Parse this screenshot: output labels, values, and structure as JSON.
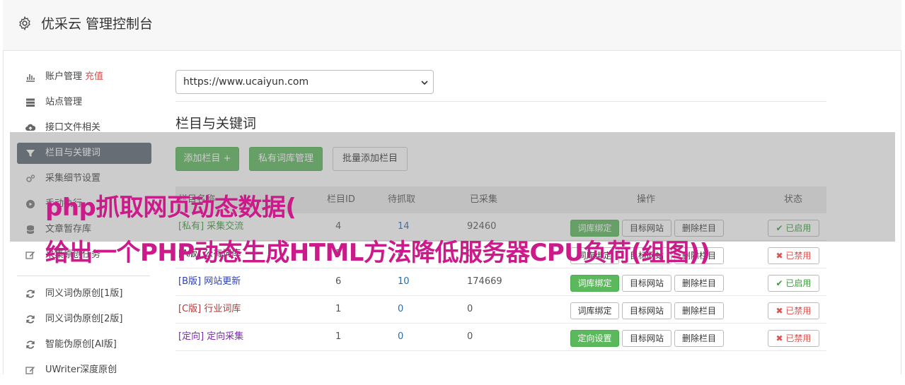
{
  "header": {
    "title": "优采云 管理控制台"
  },
  "sidebar": {
    "items": [
      {
        "label": "账户管理",
        "extra": "充值",
        "icon": "bar-chart-icon"
      },
      {
        "label": "站点管理",
        "icon": "server-icon"
      },
      {
        "label": "接口文件相关",
        "icon": "cloud-upload-icon"
      },
      {
        "label": "栏目与关键词",
        "icon": "filter-icon",
        "active": true
      },
      {
        "label": "采集细节设置",
        "icon": "cogs-icon"
      },
      {
        "label": "手动执行",
        "icon": "play-circle-icon"
      },
      {
        "label": "文章暂存库",
        "icon": "database-icon"
      },
      {
        "label": "采集原创任务",
        "icon": "edit-icon"
      }
    ],
    "items2": [
      {
        "label": "同义词伪原创[1版]",
        "icon": "refresh-icon"
      },
      {
        "label": "同义词伪原创[2版]",
        "icon": "refresh-icon"
      },
      {
        "label": "智能伪原创[AI版]",
        "icon": "refresh-icon"
      },
      {
        "label": "UWriter深度原创",
        "icon": "edit-icon"
      }
    ]
  },
  "site_select": {
    "value": "https://www.ucaiyun.com"
  },
  "section": {
    "title": "栏目与关键词"
  },
  "toolbar": {
    "add_column": "添加栏目 +",
    "private_lib": "私有词库管理",
    "batch_add": "批量添加栏目"
  },
  "table": {
    "headers": {
      "name": "栏目名称",
      "id": "栏目ID",
      "pending": "待抓取",
      "collected": "已采集",
      "ops": "操作",
      "status": "状态"
    },
    "rows": [
      {
        "tag": "[私有]",
        "name": "采集交流",
        "id": "4",
        "pending": "14",
        "collected": "92460",
        "op1": "词库绑定",
        "op2": "目标网站",
        "op3": "删除栏目",
        "status": "已启用",
        "on": true,
        "color": "#3c9a3c"
      },
      {
        "tag": "[A版]",
        "name": "公有词库",
        "id": "5",
        "pending": "8",
        "collected": "0",
        "op1": "词库绑定",
        "op2": "目标网站",
        "op3": "删除栏目",
        "status": "已禁用",
        "on": false,
        "color": "#333333"
      },
      {
        "tag": "[B版]",
        "name": "网站更新",
        "id": "6",
        "pending": "10",
        "collected": "174669",
        "op1": "词库绑定",
        "op2": "目标网站",
        "op3": "删除栏目",
        "status": "已启用",
        "on": true,
        "color": "#2b3fb8"
      },
      {
        "tag": "[C版]",
        "name": "行业词库",
        "id": "1",
        "pending": "0",
        "collected": "0",
        "op1": "词库绑定",
        "op2": "目标网站",
        "op3": "删除栏目",
        "status": "已禁用",
        "on": false,
        "color": "#b33a3a"
      },
      {
        "tag": "[定向]",
        "name": "定向采集",
        "id": "1",
        "pending": "0",
        "collected": "0",
        "op1": "定向设置",
        "op2": "目标网站",
        "op3": "删除栏目",
        "status": "已禁用",
        "on": false,
        "color": "#7a2bb0"
      }
    ]
  },
  "overlay": {
    "line1": "php抓取网页动态数据(",
    "line2": "给出一个PHP动态生成HTML方法降低服务器CPU负荷(组图))"
  }
}
